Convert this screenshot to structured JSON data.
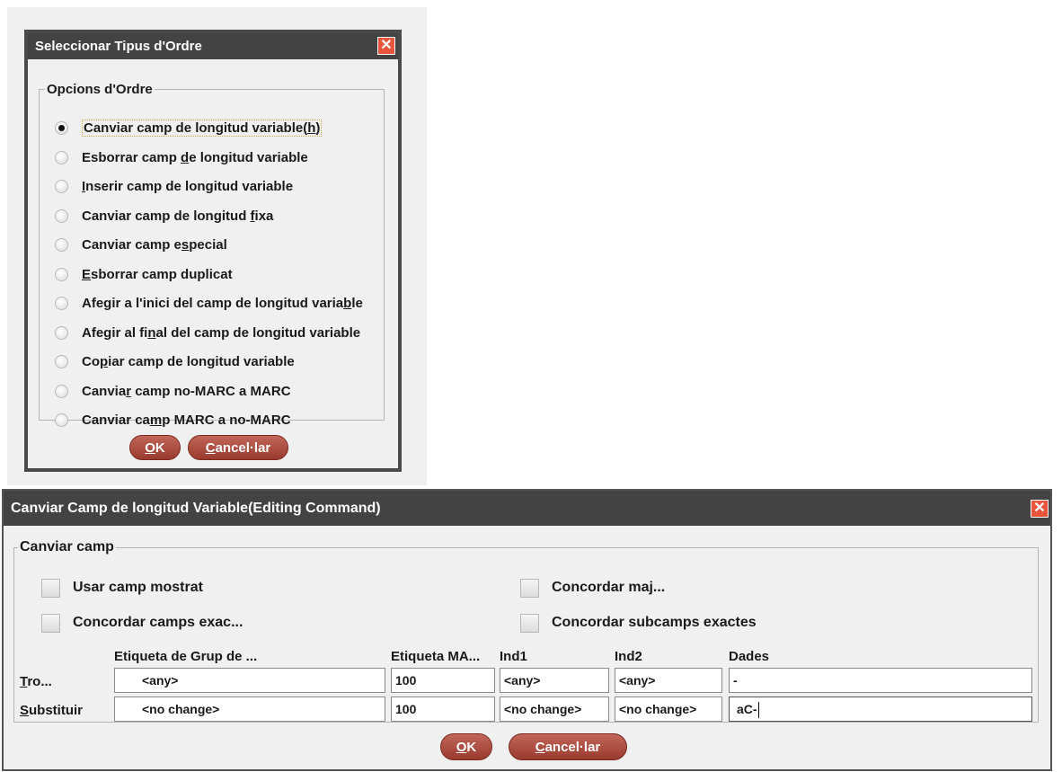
{
  "dialog_order": {
    "title": "Seleccionar Tipus d'Ordre",
    "close_glyph": "✕",
    "group_label": "Opcions d'Ordre",
    "options": [
      {
        "pre": "Canviar camp de longitud variable(",
        "mn": "h",
        "post": ")",
        "selected": true
      },
      {
        "pre": "Esborrar camp ",
        "mn": "d",
        "post": "e longitud variable",
        "selected": false
      },
      {
        "pre": "",
        "mn": "I",
        "post": "nserir camp de longitud variable",
        "selected": false
      },
      {
        "pre": "Canviar camp de longitud ",
        "mn": "f",
        "post": "ixa",
        "selected": false
      },
      {
        "pre": "Canviar camp e",
        "mn": "s",
        "post": "pecial",
        "selected": false
      },
      {
        "pre": "",
        "mn": "E",
        "post": "sborrar camp duplicat",
        "selected": false
      },
      {
        "pre": "Afegir a l'inici del camp de longitud varia",
        "mn": "b",
        "post": "le",
        "selected": false
      },
      {
        "pre": "Afegir al fi",
        "mn": "n",
        "post": "al del camp de longitud variable",
        "selected": false
      },
      {
        "pre": "Co",
        "mn": "p",
        "post": "iar camp de longitud variable",
        "selected": false
      },
      {
        "pre": "Canvia",
        "mn": "r",
        "post": " camp no-MARC a MARC",
        "selected": false
      },
      {
        "pre": "Canviar ca",
        "mn": "m",
        "post": "p MARC a no-MARC",
        "selected": false
      }
    ],
    "ok": {
      "mn": "O",
      "rest": "K"
    },
    "cancel": {
      "mn": "C",
      "rest": "ancel·lar"
    }
  },
  "dialog_edit": {
    "title": "Canviar Camp de longitud Variable(Editing Command)",
    "close_glyph": "✕",
    "group_label": "Canviar camp",
    "checkboxes": {
      "use_shown": "Usar camp mostrat",
      "match_case": "Concordar maj...",
      "match_exact_fields": "Concordar camps exac...",
      "match_exact_subfields": "Concordar subcamps exactes"
    },
    "columns": [
      "Etiqueta de Grup de ...",
      "Etiqueta MA...",
      "Ind1",
      "Ind2",
      "Dades"
    ],
    "rows": [
      {
        "label_mn": "T",
        "label_rest": "ro...",
        "cells": [
          "<any>",
          "100",
          "<any>",
          "<any>",
          "-"
        ]
      },
      {
        "label_mn": "S",
        "label_rest": "ubstituir",
        "cells": [
          "<no change>",
          "100",
          "<no change>",
          "<no change>",
          "aC-"
        ]
      }
    ],
    "ok": {
      "mn": "O",
      "rest": "K"
    },
    "cancel": {
      "mn": "C",
      "rest": "ancel·lar"
    }
  }
}
